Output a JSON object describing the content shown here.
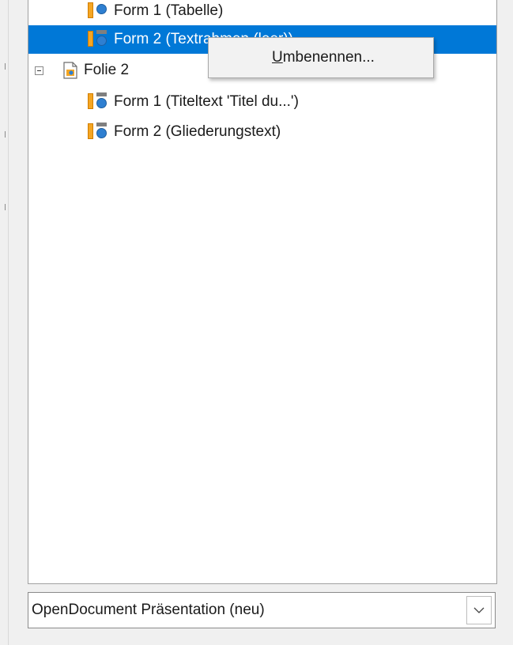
{
  "navigator": {
    "items": [
      {
        "label": "Form 1 (Tabelle)",
        "icon": "table-shape-icon",
        "selected": false
      },
      {
        "label": "Form 2 (Textrahmen (leer))",
        "icon": "text-shape-icon",
        "selected": true
      },
      {
        "label": "Folie 2",
        "icon": "slide-icon",
        "expander": "minus-expander"
      },
      {
        "label": "Form 1 (Titeltext 'Titel du...')",
        "icon": "text-shape-icon",
        "selected": false
      },
      {
        "label": "Form 2 (Gliederungstext)",
        "icon": "text-shape-icon",
        "selected": false
      }
    ]
  },
  "context_menu": {
    "rename_accel": "U",
    "rename_rest": "mbenennen..."
  },
  "document_select": {
    "value": "OpenDocument Präsentation (neu)",
    "icon": "chevron-down-icon"
  },
  "colors": {
    "selection": "#0078d7",
    "shape_bar": "#f5a623",
    "shape_circle": "#2e7fd1"
  }
}
